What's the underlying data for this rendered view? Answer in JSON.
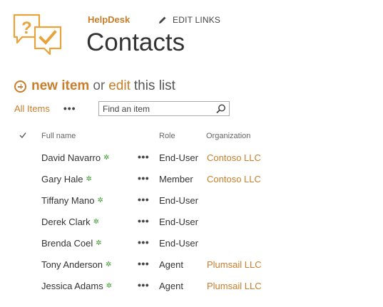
{
  "site": {
    "name": "HelpDesk",
    "edit_links_label": "EDIT LINKS",
    "brand_color": "#c87e2a"
  },
  "page": {
    "title": "Contacts"
  },
  "commands": {
    "new_item": "new item",
    "or": "or",
    "edit": "edit",
    "this_list": "this list"
  },
  "view": {
    "current": "All Items",
    "more": "•••"
  },
  "search": {
    "placeholder": "Find an item"
  },
  "columns": {
    "name": "Full name",
    "role": "Role",
    "organization": "Organization"
  },
  "rows": [
    {
      "name": "David Navarro",
      "role": "End-User",
      "organization": "Contoso LLC",
      "new": "✲"
    },
    {
      "name": "Gary Hale",
      "role": "Member",
      "organization": "Contoso LLC",
      "new": "✲"
    },
    {
      "name": "Tiffany Mano",
      "role": "End-User",
      "organization": "",
      "new": "✲"
    },
    {
      "name": "Derek Clark",
      "role": "End-User",
      "organization": "",
      "new": "✲"
    },
    {
      "name": "Brenda Coel",
      "role": "End-User",
      "organization": "",
      "new": "✲"
    },
    {
      "name": "Tony Anderson",
      "role": "Agent",
      "organization": "Plumsail LLC",
      "new": "✲"
    },
    {
      "name": "Jessica Adams",
      "role": "Agent",
      "organization": "Plumsail LLC",
      "new": "✲"
    }
  ],
  "row_menu": "•••"
}
